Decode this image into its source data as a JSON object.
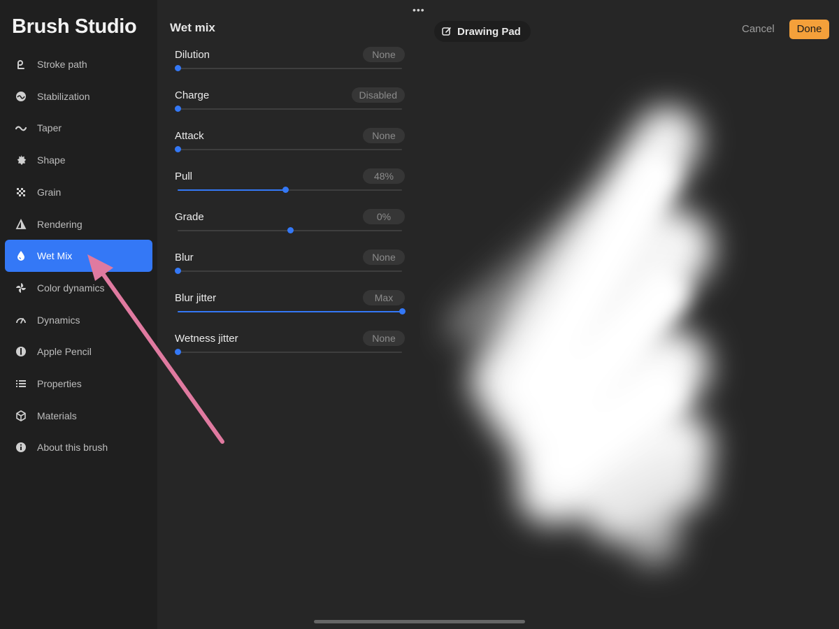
{
  "app_title": "Brush Studio",
  "sidebar": {
    "active_index": 6,
    "items": [
      {
        "label": "Stroke path",
        "icon": "stroke-path-icon"
      },
      {
        "label": "Stabilization",
        "icon": "stabilization-icon"
      },
      {
        "label": "Taper",
        "icon": "taper-icon"
      },
      {
        "label": "Shape",
        "icon": "shape-icon"
      },
      {
        "label": "Grain",
        "icon": "grain-icon"
      },
      {
        "label": "Rendering",
        "icon": "rendering-icon"
      },
      {
        "label": "Wet Mix",
        "icon": "droplet-icon"
      },
      {
        "label": "Color dynamics",
        "icon": "color-dynamics-icon"
      },
      {
        "label": "Dynamics",
        "icon": "dynamics-icon"
      },
      {
        "label": "Apple Pencil",
        "icon": "apple-pencil-icon"
      },
      {
        "label": "Properties",
        "icon": "properties-icon"
      },
      {
        "label": "Materials",
        "icon": "materials-icon"
      },
      {
        "label": "About this brush",
        "icon": "info-icon"
      }
    ]
  },
  "panel": {
    "title": "Wet mix",
    "settings": [
      {
        "label": "Dilution",
        "value_text": "None",
        "level": 0
      },
      {
        "label": "Charge",
        "value_text": "Disabled",
        "level": 0
      },
      {
        "label": "Attack",
        "value_text": "None",
        "level": 0
      },
      {
        "label": "Pull",
        "value_text": "48%",
        "level": 0.48
      },
      {
        "label": "Grade",
        "value_text": "0%",
        "level": 0.5,
        "centered": true
      },
      {
        "label": "Blur",
        "value_text": "None",
        "level": 0
      },
      {
        "label": "Blur jitter",
        "value_text": "Max",
        "level": 1
      },
      {
        "label": "Wetness jitter",
        "value_text": "None",
        "level": 0
      }
    ]
  },
  "header": {
    "more_icon": "ellipsis-icon",
    "drawing_pad_label": "Drawing Pad",
    "drawing_pad_icon": "edit-icon",
    "cancel_label": "Cancel",
    "done_label": "Done"
  },
  "colors": {
    "accent": "#3478f6",
    "done": "#f4a03a",
    "annotation_arrow": "#e07aa0"
  }
}
